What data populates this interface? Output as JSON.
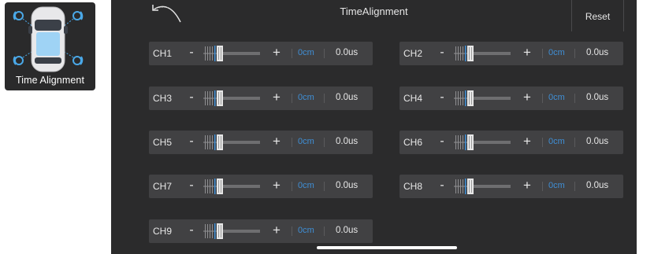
{
  "app_tile": {
    "label": "Time Alignment"
  },
  "header": {
    "title": "TimeAlignment",
    "reset_label": "Reset"
  },
  "controls": {
    "minus": "-",
    "plus": "+"
  },
  "channels": [
    {
      "name": "CH1",
      "distance": "0cm",
      "delay": "0.0us"
    },
    {
      "name": "CH2",
      "distance": "0cm",
      "delay": "0.0us"
    },
    {
      "name": "CH3",
      "distance": "0cm",
      "delay": "0.0us"
    },
    {
      "name": "CH4",
      "distance": "0cm",
      "delay": "0.0us"
    },
    {
      "name": "CH5",
      "distance": "0cm",
      "delay": "0.0us"
    },
    {
      "name": "CH6",
      "distance": "0cm",
      "delay": "0.0us"
    },
    {
      "name": "CH7",
      "distance": "0cm",
      "delay": "0.0us"
    },
    {
      "name": "CH8",
      "distance": "0cm",
      "delay": "0.0us"
    },
    {
      "name": "CH9",
      "distance": "0cm",
      "delay": "0.0us"
    }
  ],
  "colors": {
    "panel": "#2b2b2c",
    "row": "#414143",
    "accent": "#3f8fd6"
  }
}
